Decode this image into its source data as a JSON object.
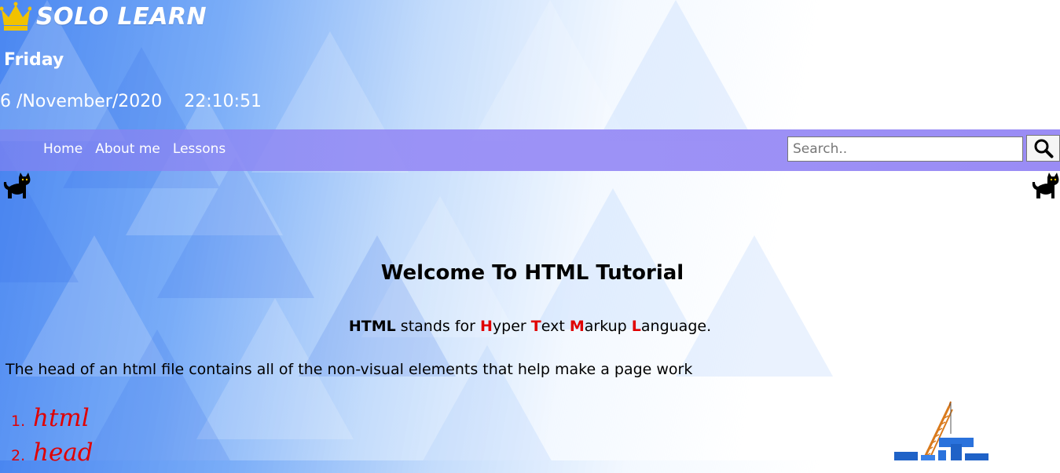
{
  "header": {
    "brand_title": "SOLO LEARN",
    "brand_icon": "crown-icon",
    "day": "Friday",
    "date": "6 /November/2020",
    "time": "22:10:51"
  },
  "nav": {
    "links": [
      {
        "label": "Home"
      },
      {
        "label": "About me"
      },
      {
        "label": "Lessons"
      }
    ],
    "search": {
      "placeholder": "Search..",
      "value": ""
    },
    "search_icon": "search-icon"
  },
  "decorations": {
    "left_icon": "cat-icon",
    "right_icon": "cat-icon"
  },
  "main": {
    "heading": "Welcome To HTML Tutorial",
    "acronym": {
      "abbr": "HTML",
      "stands_for": " stands for ",
      "parts": [
        {
          "letter": "H",
          "rest": "yper "
        },
        {
          "letter": "T",
          "rest": "ext "
        },
        {
          "letter": "M",
          "rest": "arkup "
        },
        {
          "letter": "L",
          "rest": "anguage."
        }
      ]
    },
    "head_description": "The head of an html file contains all of the non-visual elements that help make a page work",
    "list": [
      {
        "num": "1.",
        "tag": "html"
      },
      {
        "num": "2.",
        "tag": "head"
      }
    ],
    "illustration": "construction-crane-image"
  },
  "colors": {
    "accent_red": "#e00000",
    "navbar": "#9a8cf5",
    "brand_gold": "#f2c200"
  }
}
